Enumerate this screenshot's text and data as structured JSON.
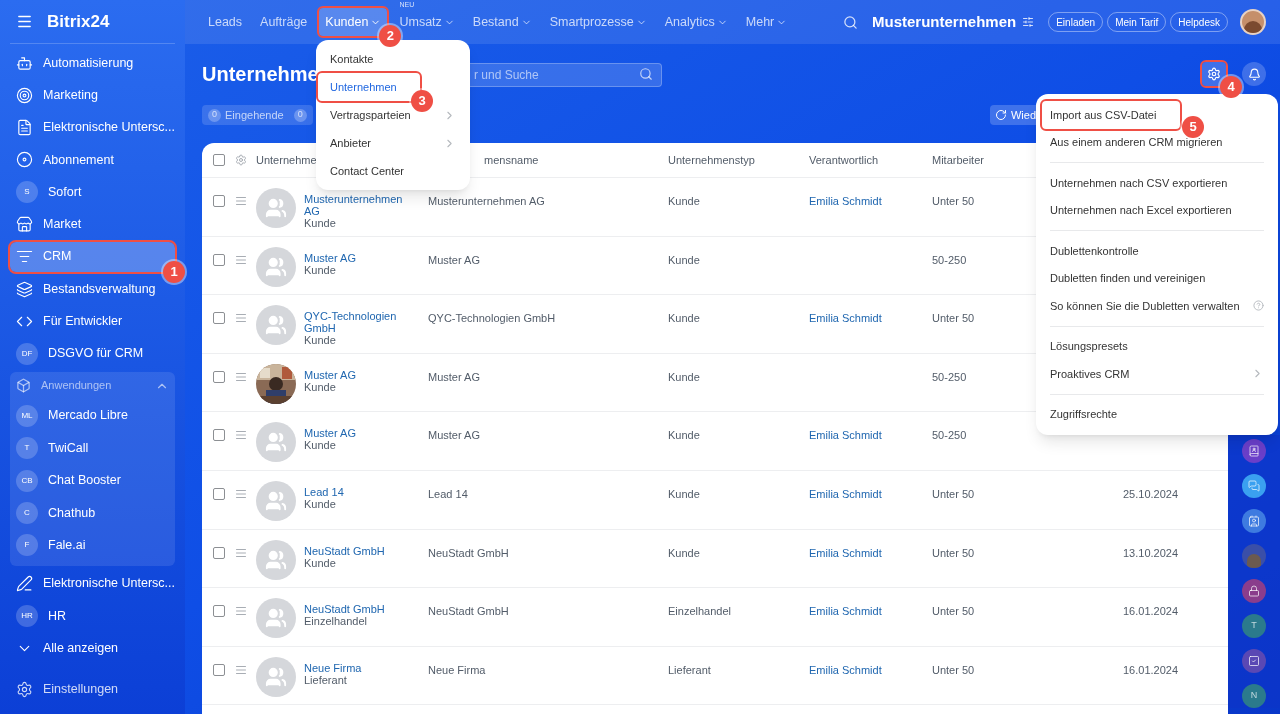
{
  "sidebar": {
    "logo": "Bitrix24",
    "items": [
      {
        "kind": "icon",
        "label": "Automatisierung",
        "selected": false
      },
      {
        "kind": "icon",
        "label": "Marketing",
        "selected": false
      },
      {
        "kind": "icon",
        "label": "Elektronische Untersc...",
        "selected": false
      },
      {
        "kind": "icon",
        "label": "Abonnement",
        "selected": false
      },
      {
        "kind": "initials",
        "initials": "S",
        "label": "Sofort",
        "selected": false
      },
      {
        "kind": "icon",
        "label": "Market",
        "selected": false
      },
      {
        "kind": "icon",
        "label": "CRM",
        "selected": true,
        "marker": "1"
      },
      {
        "kind": "icon",
        "label": "Bestandsverwaltung",
        "selected": false
      },
      {
        "kind": "icon",
        "label": "Für Entwickler",
        "selected": false
      },
      {
        "kind": "initials",
        "initials": "DF",
        "label": "DSGVO für CRM",
        "selected": false
      }
    ],
    "group": {
      "label": "Anwendungen",
      "expanded": true,
      "items": [
        {
          "initials": "ML",
          "label": "Mercado Libre"
        },
        {
          "initials": "T",
          "label": "TwiCall"
        },
        {
          "initials": "CB",
          "label": "Chat Booster"
        },
        {
          "initials": "C",
          "label": "Chathub"
        },
        {
          "initials": "F",
          "label": "Fale.ai"
        }
      ]
    },
    "after": [
      {
        "kind": "icon",
        "label": "Elektronische Untersc..."
      },
      {
        "kind": "initials",
        "initials": "HR",
        "label": "HR"
      },
      {
        "kind": "more",
        "label": "Alle anzeigen"
      }
    ],
    "settings": "Einstellungen"
  },
  "topbar": {
    "nav": [
      {
        "label": "Leads",
        "selected": false,
        "dropdown": false
      },
      {
        "label": "Aufträge",
        "selected": false,
        "dropdown": false
      },
      {
        "label": "Kunden",
        "selected": true,
        "dropdown": true,
        "marker": "2"
      },
      {
        "label": "Umsatz",
        "selected": false,
        "dropdown": true,
        "tag": "NEU"
      },
      {
        "label": "Bestand",
        "selected": false,
        "dropdown": true
      },
      {
        "label": "Smartprozesse",
        "selected": false,
        "dropdown": true
      },
      {
        "label": "Analytics",
        "selected": false,
        "dropdown": true
      },
      {
        "label": "Mehr",
        "selected": false,
        "dropdown": true
      }
    ],
    "company": "Musterunternehmen",
    "buttons": [
      "Einladen",
      "Mein Tarif",
      "Helpdesk"
    ]
  },
  "kunden_menu": [
    {
      "label": "Kontakte",
      "selected": false,
      "submenu": false
    },
    {
      "label": "Unternehmen",
      "selected": true,
      "submenu": false,
      "marker": "3"
    },
    {
      "label": "Vertragsparteien",
      "selected": false,
      "submenu": true
    },
    {
      "label": "Anbieter",
      "selected": false,
      "submenu": true
    },
    {
      "label": "Contact Center",
      "selected": false,
      "submenu": false
    }
  ],
  "page": {
    "title": "Unternehme",
    "search": {
      "placeholder": "r und Suche"
    },
    "counters": [
      {
        "count": "0",
        "label": "Eingehende"
      },
      {
        "count": "0"
      }
    ],
    "repeat_button": "Wied",
    "settings_marker": "4"
  },
  "settings_menu": [
    [
      {
        "label": "Import aus CSV-Datei",
        "help": false,
        "submenu": false,
        "marker": "5"
      },
      {
        "label": "Aus einem anderen CRM migrieren",
        "help": false,
        "submenu": false
      }
    ],
    [
      {
        "label": "Unternehmen nach CSV exportieren",
        "help": false,
        "submenu": false
      },
      {
        "label": "Unternehmen nach Excel exportieren",
        "help": false,
        "submenu": false
      }
    ],
    [
      {
        "label": "Dublettenkontrolle",
        "help": false,
        "submenu": false
      },
      {
        "label": "Dubletten finden und vereinigen",
        "help": false,
        "submenu": false
      },
      {
        "label": "So können Sie die Dubletten verwalten",
        "help": true,
        "submenu": false
      }
    ],
    [
      {
        "label": "Lösungspresets",
        "help": false,
        "submenu": false
      },
      {
        "label": "Proaktives CRM",
        "help": false,
        "submenu": true
      }
    ],
    [
      {
        "label": "Zugriffsrechte",
        "help": false,
        "submenu": false
      }
    ]
  ],
  "table": {
    "header_checked": false,
    "columns": [
      "Unternehme",
      "mensname",
      "Unternehmenstyp",
      "Verantwortlich",
      "Mitarbeiter"
    ],
    "rows": [
      {
        "name": "Musterunternehmen AG",
        "type_label": "Kunde",
        "company_name": "Musterunternehmen AG",
        "company_type": "Kunde",
        "responsible": "Emilia Schmidt",
        "employees": "Unter 50",
        "photo": false,
        "checked": false
      },
      {
        "name": "Muster AG",
        "type_label": "Kunde",
        "company_name": "Muster AG",
        "company_type": "Kunde",
        "employees": "50-250",
        "photo": false,
        "checked": false
      },
      {
        "name": "QYC-Technologien GmbH",
        "type_label": "Kunde",
        "company_name": "QYC-Technologien GmbH",
        "company_type": "Kunde",
        "responsible": "Emilia Schmidt",
        "employees": "Unter 50",
        "photo": false,
        "checked": false
      },
      {
        "name": "Muster AG",
        "type_label": "Kunde",
        "company_name": "Muster AG",
        "company_type": "Kunde",
        "employees": "50-250",
        "photo": true,
        "checked": false
      },
      {
        "name": "Muster AG",
        "type_label": "Kunde",
        "company_name": "Muster AG",
        "company_type": "Kunde",
        "responsible": "Emilia Schmidt",
        "employees": "50-250",
        "photo": false,
        "checked": false
      },
      {
        "name": "Lead 14",
        "type_label": "Kunde",
        "company_name": "Lead 14",
        "company_type": "Kunde",
        "responsible": "Emilia Schmidt",
        "employees": "Unter 50",
        "date": "25.10.2024",
        "photo": false,
        "checked": false
      },
      {
        "name": "NeuStadt GmbH",
        "type_label": "Kunde",
        "company_name": "NeuStadt GmbH",
        "company_type": "Kunde",
        "responsible": "Emilia Schmidt",
        "employees": "Unter 50",
        "date": "13.10.2024",
        "photo": false,
        "checked": false
      },
      {
        "name": "NeuStadt GmbH",
        "type_label": "Einzelhandel",
        "company_name": "NeuStadt GmbH",
        "company_type": "Einzelhandel",
        "responsible": "Emilia Schmidt",
        "employees": "Unter 50",
        "date": "16.01.2024",
        "photo": false,
        "checked": false
      },
      {
        "name": "Neue Firma",
        "type_label": "Lieferant",
        "company_name": "Neue Firma",
        "company_type": "Lieferant",
        "responsible": "Emilia Schmidt",
        "employees": "Unter 50",
        "date": "16.01.2024",
        "photo": false,
        "checked": false
      }
    ]
  },
  "rail": [
    {
      "kind": "icon",
      "color": "#6a3fc9"
    },
    {
      "kind": "icon",
      "color": "#3aa0f0"
    },
    {
      "kind": "icon",
      "color": "#3e7be0"
    },
    {
      "kind": "avatar",
      "color": "#3a4fa8"
    },
    {
      "kind": "icon",
      "color": "#8a3d8c"
    },
    {
      "kind": "letter",
      "letter": "T",
      "color": "#2b7a8c"
    },
    {
      "kind": "icon",
      "color": "#5a48b4"
    },
    {
      "kind": "letter",
      "letter": "N",
      "color": "#2b7a8c"
    }
  ]
}
